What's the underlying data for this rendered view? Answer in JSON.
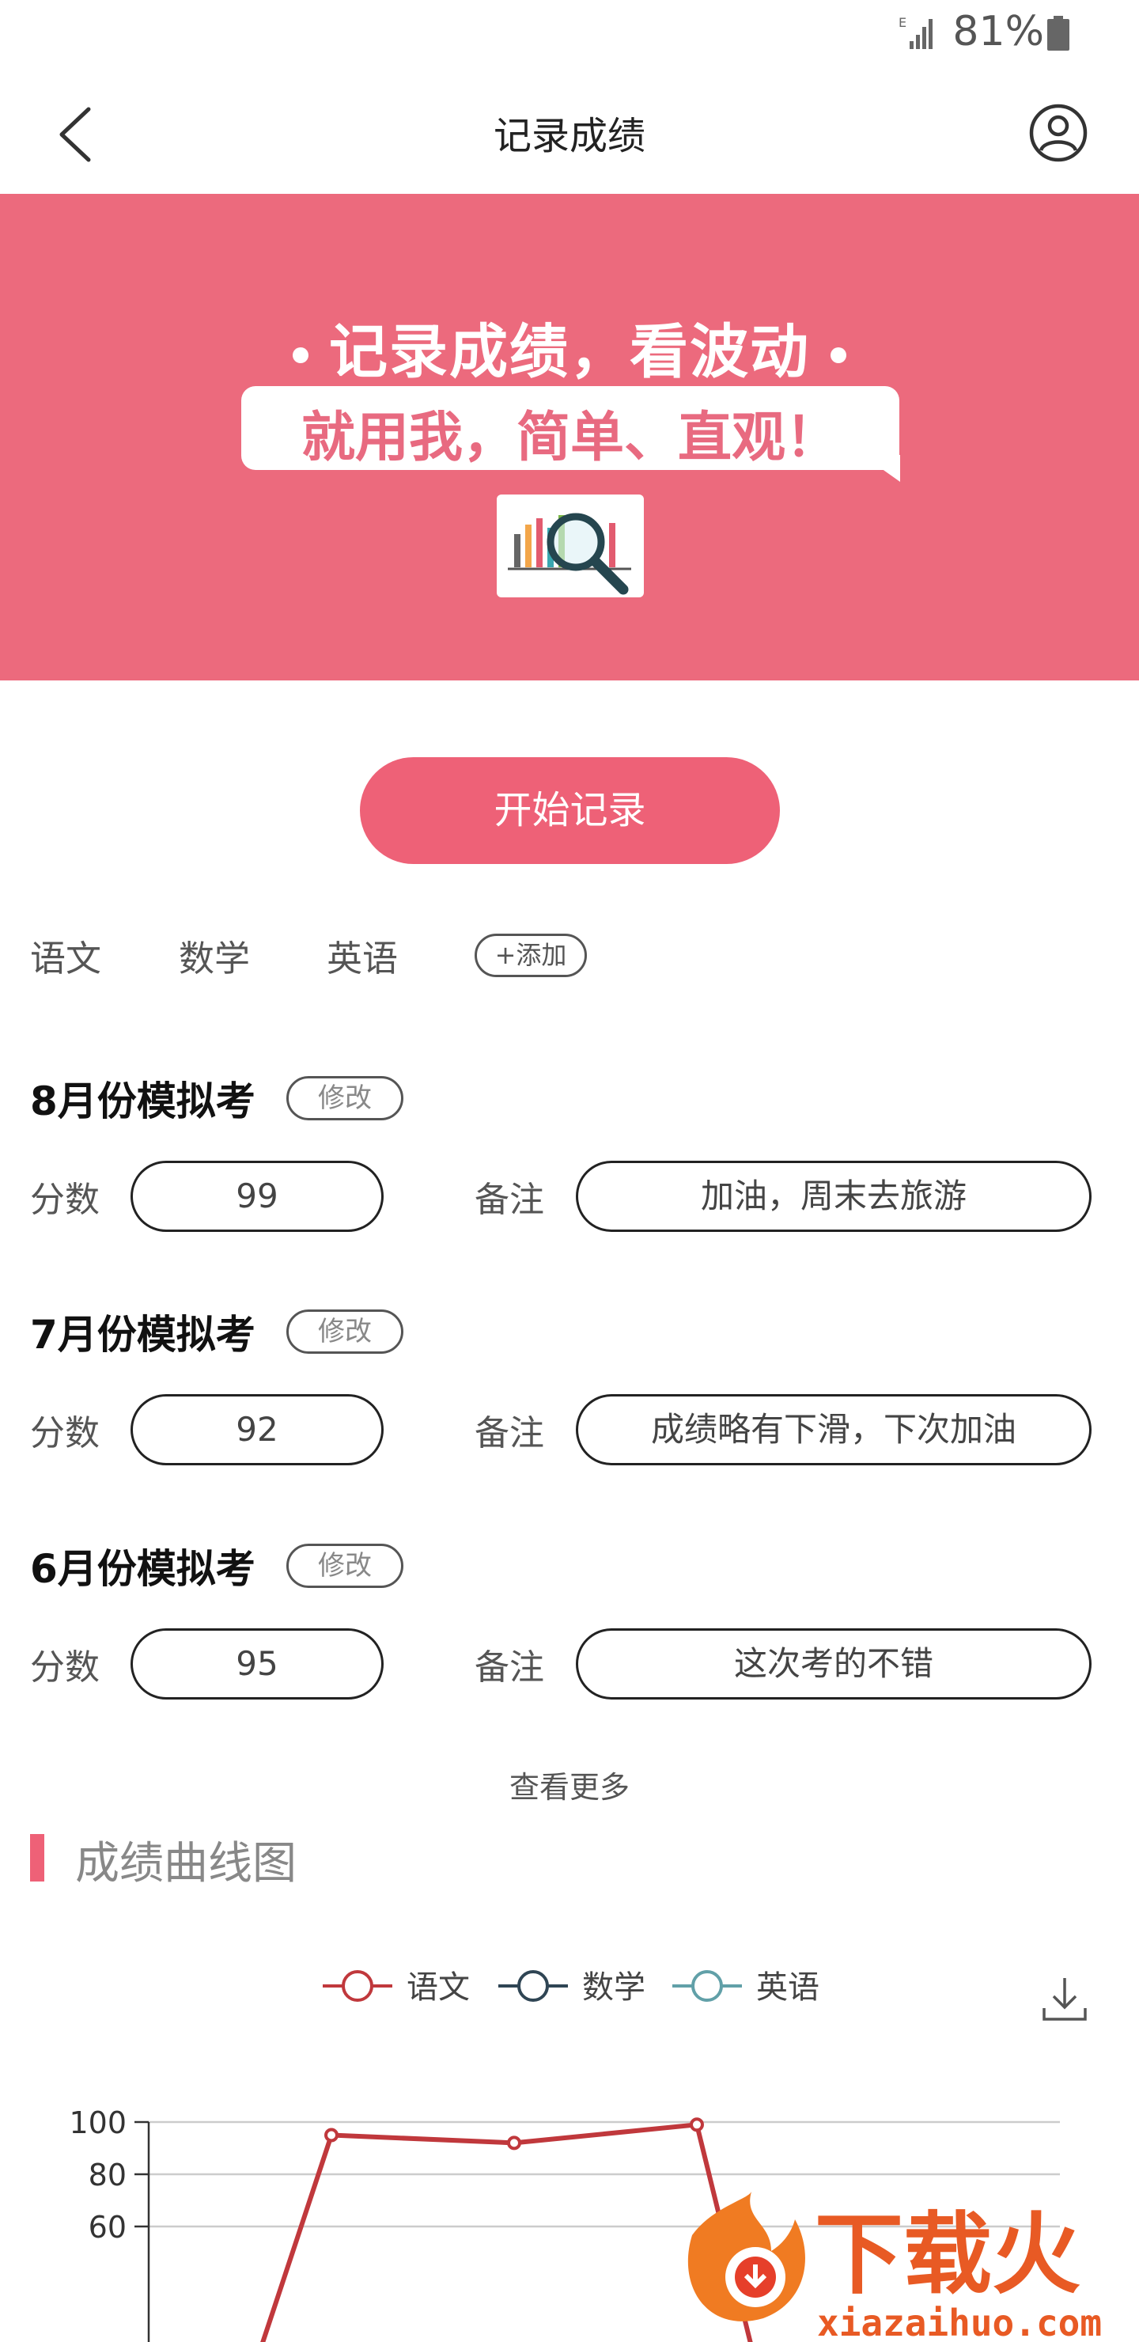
{
  "status_bar": {
    "battery_percent": "81%",
    "network_label": "E"
  },
  "header": {
    "title": "记录成绩"
  },
  "banner": {
    "headline": "记录成绩，看波动",
    "slogan": "就用我，简单、直观！"
  },
  "actions": {
    "start_label": "开始记录"
  },
  "subjects": {
    "items": [
      "语文",
      "数学",
      "英语"
    ],
    "add_label": "添加"
  },
  "records": [
    {
      "title": "8月份模拟考",
      "edit_label": "修改",
      "score_label": "分数",
      "score": "99",
      "note_label": "备注",
      "note": "加油，周末去旅游"
    },
    {
      "title": "7月份模拟考",
      "edit_label": "修改",
      "score_label": "分数",
      "score": "92",
      "note_label": "备注",
      "note": "成绩略有下滑，下次加油"
    },
    {
      "title": "6月份模拟考",
      "edit_label": "修改",
      "score_label": "分数",
      "score": "95",
      "note_label": "备注",
      "note": "这次考的不错"
    }
  ],
  "more_label": "查看更多",
  "chart_section": {
    "title": "成绩曲线图"
  },
  "chart_data": {
    "type": "line",
    "y_ticks": [
      100,
      80,
      60
    ],
    "ylim": [
      50,
      100
    ],
    "grid": true,
    "legend_position": "top-center",
    "series": [
      {
        "name": "语文",
        "color": "#c0383c",
        "values": [
          null,
          95,
          92,
          99
        ]
      },
      {
        "name": "数学",
        "color": "#2f4554",
        "values": []
      },
      {
        "name": "英语",
        "color": "#61a0a8",
        "values": []
      }
    ],
    "visible_partial": [
      {
        "series": "语文",
        "from_index": 3,
        "direction": "down"
      },
      {
        "series": "语文",
        "from_index": 0,
        "direction": "up-into"
      }
    ]
  },
  "watermark": {
    "brand": "下载火",
    "domain": "xiazaihuo.com"
  },
  "colors": {
    "accent": "#ee6177",
    "banner": "#ec6a7d"
  }
}
